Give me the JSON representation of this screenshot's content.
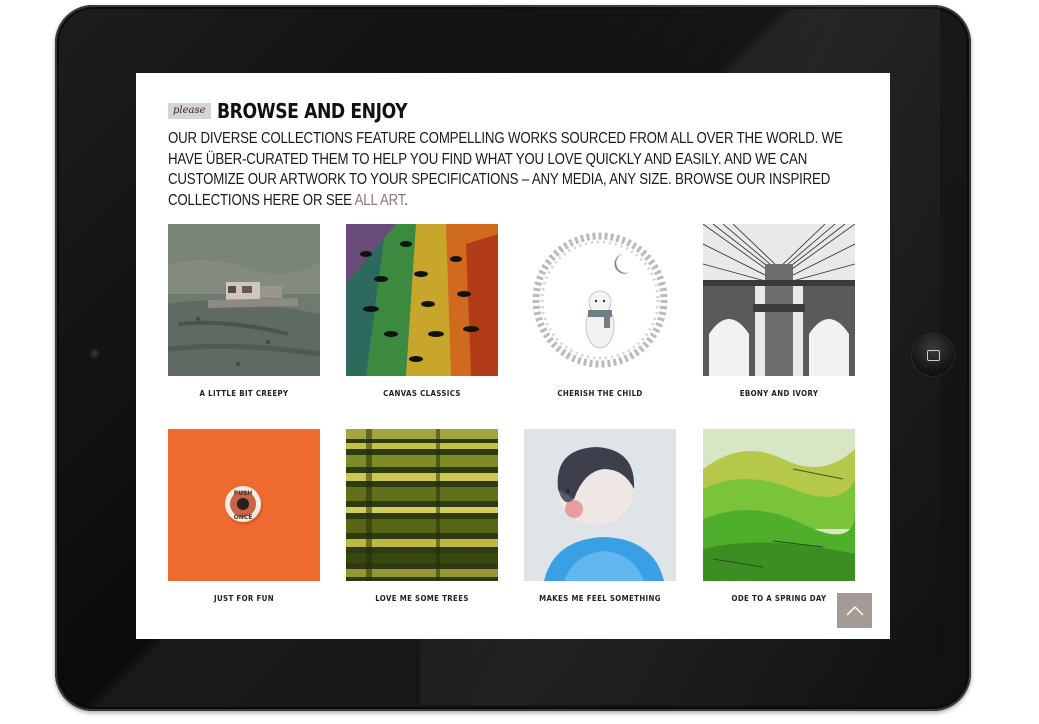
{
  "header": {
    "tag": "please",
    "title": "BROWSE AND ENJOY"
  },
  "intro": {
    "text": "OUR DIVERSE COLLECTIONS FEATURE COMPELLING WORKS SOURCED FROM ALL OVER THE WORLD. WE HAVE ÜBER-CURATED THEM TO HELP YOU FIND WHAT YOU LOVE QUICKLY AND EASILY. AND WE CAN CUSTOMIZE OUR ARTWORK TO YOUR SPECIFICATIONS – ANY MEDIA, ANY SIZE. BROWSE OUR INSPIRED COLLECTIONS HERE OR SEE ",
    "link_label": "ALL ART",
    "end": "."
  },
  "collections": [
    {
      "label": "A LITTLE BIT CREEPY"
    },
    {
      "label": "CANVAS CLASSICS"
    },
    {
      "label": "CHERISH THE CHILD"
    },
    {
      "label": "EBONY AND IVORY"
    },
    {
      "label": "JUST FOR FUN"
    },
    {
      "label": "LOVE ME SOME TREES"
    },
    {
      "label": "MAKES ME FEEL SOMETHING"
    },
    {
      "label": "ODE TO A SPRING DAY"
    }
  ],
  "button_text": {
    "push_line1": "PUSH",
    "push_line2": "ONCE"
  },
  "colors": {
    "accent_link": "#8b7770",
    "scroll_button": "#a59b96",
    "tag_bg": "#d9d4cf"
  },
  "icons": {
    "scroll_top": "chevron-up-icon",
    "home": "home-button-icon"
  }
}
